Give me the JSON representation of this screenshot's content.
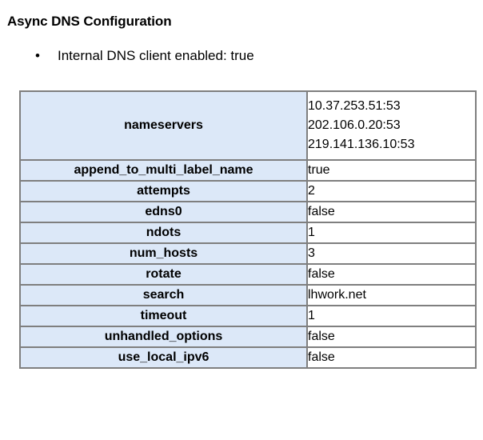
{
  "page": {
    "title": "Async DNS Configuration"
  },
  "bullets": [
    {
      "marker": "•",
      "text": "Internal DNS client enabled: true"
    }
  ],
  "table": {
    "rows": [
      {
        "key": "nameservers",
        "value": "10.37.253.51:53\n202.106.0.20:53\n219.141.136.10:53"
      },
      {
        "key": "append_to_multi_label_name",
        "value": "true"
      },
      {
        "key": "attempts",
        "value": "2"
      },
      {
        "key": "edns0",
        "value": "false"
      },
      {
        "key": "ndots",
        "value": "1"
      },
      {
        "key": "num_hosts",
        "value": "3"
      },
      {
        "key": "rotate",
        "value": "false"
      },
      {
        "key": "search",
        "value": "lhwork.net"
      },
      {
        "key": "timeout",
        "value": "1"
      },
      {
        "key": "unhandled_options",
        "value": "false"
      },
      {
        "key": "use_local_ipv6",
        "value": "false"
      }
    ]
  },
  "colors": {
    "key_cell_background": "#dce8f8",
    "value_cell_background": "#ffffff",
    "border": "#7f7f7f",
    "text": "#000000",
    "page_background": "#ffffff"
  }
}
